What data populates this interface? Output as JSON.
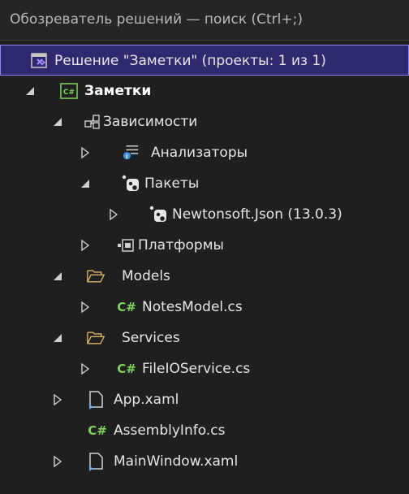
{
  "search": {
    "text": "Обозреватель решений — поиск (Ctrl+;)"
  },
  "solution": {
    "label": "Решение \"Заметки\" (проекты: 1 из 1)"
  },
  "tree": {
    "project": "Заметки",
    "dependencies": "Зависимости",
    "analyzers": "Анализаторы",
    "packages": "Пакеты",
    "newtonsoft": "Newtonsoft.Json (13.0.3)",
    "platforms": "Платформы",
    "models": "Models",
    "notesmodel": "NotesModel.cs",
    "services": "Services",
    "fileioservice": "FileIOService.cs",
    "appxaml": "App.xaml",
    "assemblyinfo": "AssemblyInfo.cs",
    "mainwindow": "MainWindow.xaml"
  },
  "icons": {
    "cs_glyph": "C#"
  },
  "colors": {
    "background": "#1f1f1f",
    "selection": "#2d2a70",
    "selection_border": "#8a82ff",
    "csharp": "#7fd35b",
    "folder": "#d9b36c"
  }
}
